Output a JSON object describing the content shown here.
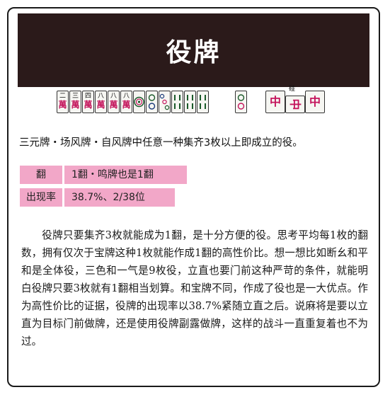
{
  "title": "役牌",
  "pon_label": "碰",
  "icons": {
    "man_tiles": "mahjong-man-tile-icon",
    "pin_tiles": "mahjong-pin-tile-icon",
    "sou_tiles": "mahjong-sou-tile-icon",
    "chun_tile": "mahjong-chun-tile-icon"
  },
  "tiles": {
    "man": [
      {
        "top": "二",
        "bottom": "萬"
      },
      {
        "top": "三",
        "bottom": "萬"
      },
      {
        "top": "四",
        "bottom": "萬"
      },
      {
        "top": "八",
        "bottom": "萬"
      },
      {
        "top": "八",
        "bottom": "萬"
      },
      {
        "top": "八",
        "bottom": "萬"
      }
    ],
    "chun": "中"
  },
  "description": "三元牌・场风牌・自风牌中任意一种集齐3枚以上即成立的役。",
  "info_rows": [
    {
      "label": "翻",
      "value": "1翻・鸣牌也是1翻"
    },
    {
      "label": "出现率",
      "value": "38.7%、2/38位"
    }
  ],
  "body": "役牌只要集齐3枚就能成为1翻，是十分方便的役。思考平均每1枚的翻数，拥有仅次于宝牌这种1枚就能作成1翻的高性价比。想一想比如断幺和平和是全体役，三色和一气是9枚役，立直也要门前这种严苛的条件，就能明白役牌只要3枚就有1翻相当划算。和宝牌不同，作成了役也是一大优点。作为高性价比的证据，役牌的出现率以38.7%紧随立直之后。说麻将是要以立直为目标门前做牌，还是使用役牌副露做牌，这样的战斗一直重复着也不为过。",
  "colors": {
    "banner": "#2b1a1a",
    "label_bg": "#f2a7c8",
    "manzu_red": "#c4145c"
  }
}
